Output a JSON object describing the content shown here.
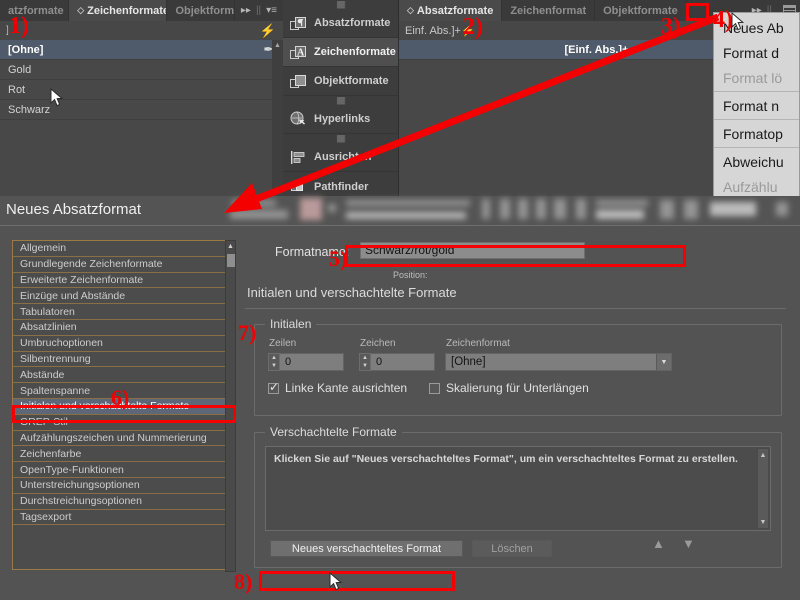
{
  "left_panel": {
    "tabs": [
      {
        "label": "atzformate",
        "active": false
      },
      {
        "label": "Zeichenformate",
        "active": true
      },
      {
        "label": "Objektformate",
        "active": false
      }
    ],
    "controls": {
      "expand": "▸▸",
      "divider": "||",
      "menu": "▾≡"
    },
    "subbar_label": "]",
    "bolt_icon": "⚡",
    "rows": [
      {
        "label": "[Ohne]",
        "selected": true,
        "nib": "✒"
      },
      {
        "label": "Gold",
        "selected": false
      },
      {
        "label": "Rot",
        "selected": false
      },
      {
        "label": "Schwarz",
        "selected": false
      }
    ]
  },
  "dock_panel": {
    "items": [
      {
        "label": "Absatzformate",
        "icon": "paragraph-style-icon",
        "active": false
      },
      {
        "label": "Zeichenformate",
        "icon": "character-style-icon",
        "active": true
      },
      {
        "label": "Objektformate",
        "icon": "object-style-icon",
        "active": false
      },
      {
        "label": "Hyperlinks",
        "icon": "hyperlinks-icon",
        "active": false
      },
      {
        "label": "Ausrichten",
        "icon": "align-icon",
        "active": false
      },
      {
        "label": "Pathfinder",
        "icon": "pathfinder-icon",
        "active": false
      }
    ]
  },
  "right_panel": {
    "tabs": [
      {
        "label": "Absatzformate",
        "active": true
      },
      {
        "label": "Zeichenformat",
        "active": false
      },
      {
        "label": "Objektformate",
        "active": false
      }
    ],
    "expand_icon": "▸▸",
    "divider": "||",
    "menu_icon": "panel-menu-icon",
    "subbar_label": "Einf. Abs.]+",
    "bolt_icon": "⚡",
    "rows": [
      {
        "label": "[Einf. Abs.]+",
        "selected": true
      }
    ]
  },
  "flyout_menu": {
    "items": [
      {
        "label": "Neues Ab",
        "disabled": false
      },
      {
        "label": "Format d",
        "disabled": false
      },
      {
        "label": "Format lö",
        "disabled": true
      },
      {
        "label": "Format n",
        "disabled": false
      },
      {
        "label": "Formatop",
        "disabled": false
      },
      {
        "label": "Abweichu",
        "disabled": false
      },
      {
        "label": "Aufzählu",
        "disabled": true
      }
    ]
  },
  "dialog": {
    "title": "Neues Absatzformat",
    "nav_items": [
      {
        "label": "Allgemein",
        "selected": false
      },
      {
        "label": "Grundlegende Zeichenformate",
        "selected": false
      },
      {
        "label": "Erweiterte Zeichenformate",
        "selected": false
      },
      {
        "label": "Einzüge und Abstände",
        "selected": false
      },
      {
        "label": "Tabulatoren",
        "selected": false
      },
      {
        "label": "Absatzlinien",
        "selected": false
      },
      {
        "label": "Umbruchoptionen",
        "selected": false
      },
      {
        "label": "Silbentrennung",
        "selected": false
      },
      {
        "label": "Abstände",
        "selected": false
      },
      {
        "label": "Spaltenspanne",
        "selected": false
      },
      {
        "label": "Initialen und verschachtelte Formate",
        "selected": true
      },
      {
        "label": "GREP-Stil",
        "selected": false
      },
      {
        "label": "Aufzählungszeichen und Nummerierung",
        "selected": false
      },
      {
        "label": "Zeichenfarbe",
        "selected": false
      },
      {
        "label": "OpenType-Funktionen",
        "selected": false
      },
      {
        "label": "Unterstreichungsoptionen",
        "selected": false
      },
      {
        "label": "Durchstreichungsoptionen",
        "selected": false
      },
      {
        "label": "Tagsexport",
        "selected": false
      }
    ],
    "format_name_label": "Formatname:",
    "format_name_value": "Schwarz/rot/gold",
    "position_label": "Position:",
    "page_heading": "Initialen und verschachtelte Formate",
    "initialen": {
      "legend": "Initialen",
      "lines_label": "Zeilen",
      "lines_value": "0",
      "chars_label": "Zeichen",
      "chars_value": "0",
      "charstyle_label": "Zeichenformat",
      "charstyle_value": "[Ohne]",
      "align_left_edge": "Linke Kante ausrichten",
      "align_left_edge_checked": true,
      "scale_descenders": "Skalierung für Unterlängen",
      "scale_descenders_checked": false
    },
    "nested": {
      "legend": "Verschachtelte Formate",
      "hint": "Klicken Sie auf \"Neues verschachteltes Format\", um ein verschachteltes Format zu erstellen.",
      "new_button": "Neues verschachteltes Format",
      "delete_button": "Löschen",
      "move_up_icon": "▲",
      "move_down_icon": "▼"
    }
  },
  "annotations": [
    {
      "id": "1",
      "label": "1)"
    },
    {
      "id": "2",
      "label": "2)"
    },
    {
      "id": "3",
      "label": "3)"
    },
    {
      "id": "4",
      "label": "4)"
    },
    {
      "id": "5",
      "label": "5)"
    },
    {
      "id": "6",
      "label": "6)"
    },
    {
      "id": "7",
      "label": "7)"
    },
    {
      "id": "8",
      "label": "8)"
    }
  ],
  "colors": {
    "annotation_red": "#f50000",
    "panel_bg": "#474747",
    "dialog_bg": "#535353",
    "selection_blue": "#4f5a6b",
    "nav_selection": "#5d6778",
    "nav_border_gold": "#9c7a43"
  }
}
